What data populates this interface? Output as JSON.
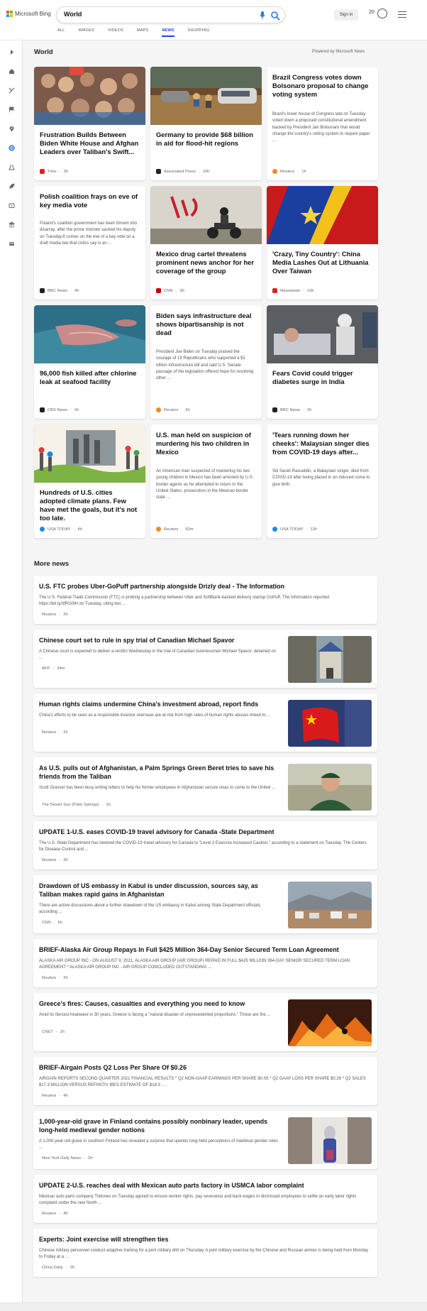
{
  "brand": {
    "name": "Microsoft Bing",
    "colors": [
      "#f25022",
      "#7fba00",
      "#00a4ef",
      "#ffb900"
    ]
  },
  "search": {
    "query": "World",
    "mic_icon": "microphone-icon",
    "search_icon": "search-icon"
  },
  "header": {
    "sign_in": "Sign in",
    "reward_points": "20"
  },
  "tabs": [
    "ALL",
    "IMAGES",
    "VIDEOS",
    "MAPS",
    "NEWS",
    "SHOPPING"
  ],
  "active_tab": "NEWS",
  "rail_icons": [
    "chevron-right-icon",
    "home-icon",
    "sports-icon",
    "flag-icon",
    "location-pin-icon",
    "globe-icon",
    "science-icon",
    "rocket-icon",
    "video-icon",
    "bank-icon",
    "card-icon"
  ],
  "world": {
    "title": "World",
    "powered_by": "Powered by Microsoft News",
    "cards": [
      {
        "title": "Frustration Builds Between Biden White House and Afghan Leaders over Taliban's Swift...",
        "source": "Time",
        "age": "3h",
        "snippet": "",
        "image": "crowd-photo",
        "source_color": "#e02020"
      },
      {
        "title": "Germany to provide $68 billion in aid for flood-hit regions",
        "source": "Associated Press",
        "age": "10h",
        "snippet": "",
        "image": "flood-photo",
        "source_color": "#222222"
      },
      {
        "title": "Brazil Congress votes down Bolsonaro proposal to change voting system",
        "source": "Reuters",
        "age": "1h",
        "snippet": "Brazil's lower house of Congress late on Tuesday voted down a proposed constitutional amendment backed by President Jair Bolsonaro that would change the country's voting system to require paper ...",
        "image": "",
        "source_color": "#f08a24"
      },
      {
        "title": "Polish coalition frays on eve of key media vote",
        "source": "BBC News",
        "age": "4h",
        "snippet": "Poland's coalition government has been thrown into disarray, after the prime minister sacked his deputy on Tuesday.It comes on the eve of a key vote on a draft media law that critics say is an ...",
        "image": "",
        "source_color": "#222222"
      },
      {
        "title": "Mexico drug cartel threatens prominent news anchor for her coverage of the group",
        "source": "CNN",
        "age": "3h",
        "snippet": "",
        "image": "motorbike-photo",
        "source_color": "#cc0000"
      },
      {
        "title": "'Crazy, Tiny Country': China Media Lashes Out at Lithuania Over Taiwan",
        "source": "Newsweek",
        "age": "10h",
        "snippet": "",
        "image": "flag-photo",
        "source_color": "#e02020"
      },
      {
        "title": "96,000 fish killed after chlorine leak at seafood facility",
        "source": "CBS News",
        "age": "2h",
        "snippet": "",
        "image": "fish-photo",
        "source_color": "#222222"
      },
      {
        "title": "Biden says infrastructure deal shows bipartisanship is not dead",
        "source": "Reuters",
        "age": "2h",
        "snippet": "President Joe Biden on Tuesday praised the courage of 19 Republicans who supported a $1 trillion infrastructure bill and said U.S. Senate passage of the legislation offered hope for resolving other ...",
        "image": "",
        "source_color": "#f08a24"
      },
      {
        "title": "Fears Covid could trigger diabetes surge in India",
        "source": "BBC News",
        "age": "2h",
        "snippet": "",
        "image": "hospital-photo",
        "source_color": "#222222"
      },
      {
        "title": "Hundreds of U.S. cities adopted climate plans. Few have met the goals, but it's not too late.",
        "source": "USA TODAY",
        "age": "4h",
        "snippet": "",
        "image": "climate-illustration",
        "source_color": "#1d8ae0"
      },
      {
        "title": "U.S. man held on suspicion of murdering his two children in Mexico",
        "source": "Reuters",
        "age": "50m",
        "snippet": "An American man suspected of murdering his two young children in Mexico has been arrested by U.S. border agents as he attempted to return to the United States, prosecutors in the Mexican border state ...",
        "image": "",
        "source_color": "#f08a24"
      },
      {
        "title": "'Tears running down her cheeks': Malaysian singer dies from COVID-19 days after...",
        "source": "USA TODAY",
        "age": "12h",
        "snippet": "Siti Sarah Raisuddin, a Malaysian singer, died from COVID-19 after being placed in an induced coma to give birth.",
        "image": "",
        "source_color": "#1d8ae0"
      }
    ]
  },
  "more_news": {
    "title": "More news",
    "items": [
      {
        "title": "U.S. FTC probes Uber-GoPuff partnership alongside Drizly deal - The Information",
        "snippet": "The U.S. Federal Trade Commission (FTC) is probing a partnership between Uber and SoftBank-backed delivery startup GoPuff, The Information reported https://bit.ly/3fRG0lH on Tuesday, citing two ...",
        "source": "Reuters",
        "age": "2h",
        "image": "",
        "source_color": "#f08a24"
      },
      {
        "title": "Chinese court set to rule in spy trial of Canadian Michael Spavor",
        "snippet": "A Chinese court is expected to deliver a verdict Wednesday in the trial of Canadian businessman Michael Spavor, detained on ...",
        "source": "AFP",
        "age": "34m",
        "image": "courthouse-photo",
        "source_color": "#1f6fd6"
      },
      {
        "title": "Human rights claims undermine China's investment abroad, report finds",
        "snippet": "China's efforts to be seen as a responsible investor overseas are at risk from high rates of human rights abuses linked to ...",
        "source": "Reuters",
        "age": "2h",
        "image": "china-flag-photo",
        "source_color": "#f08a24"
      },
      {
        "title": "As U.S. pulls out of Afghanistan, a Palm Springs Green Beret tries to save his friends from the Taliban",
        "snippet": "Scott Grasser has been busy writing letters to help his former employees in Afghanistan secure visas to come to the United ...",
        "source": "The Desert Sun (Palm Springs)",
        "age": "1h",
        "image": "soldier-photo",
        "source_color": "#3d7fc0"
      },
      {
        "title": "UPDATE 1-U.S. eases COVID-19 travel advisory for Canada -State Department",
        "snippet": "The U.S. State Department has lowered the COVID-19 travel advisory for Canada to \"Level 2 Exercise Increased Caution,\" according to a statement on Tuesday. The Centers for Disease Control and ...",
        "source": "Reuters",
        "age": "3h",
        "image": "",
        "source_color": "#f08a24"
      },
      {
        "title": "Drawdown of US embassy in Kabul is under discussion, sources say, as Taliban makes rapid gains in Afghanistan",
        "snippet": "There are active discussions about a further drawdown of the US embassy in Kabul among State Department officials, according ...",
        "source": "CNN",
        "age": "5h",
        "image": "kabul-photo",
        "source_color": "#cc0000"
      },
      {
        "title": "BRIEF-Alaska Air Group Repays In Full $425 Million 364-Day Senior Secured Term Loan Agreement",
        "snippet": "ALASKA AIR GROUP INC - ON AUGUST 9, 2021, ALASKA AIR GROUP (AIR GROUP) REPAID IN FULL $425 MILLION 364-DAY SENIOR SECURED TERM LOAN AGREEMENT * ALASKA AIR GROUP INC - AIR GROUP CONCLUDED OUTSTANDING ...",
        "source": "Reuters",
        "age": "3h",
        "image": "",
        "source_color": "#f08a24"
      },
      {
        "title": "Greece's fires: Causes, casualties and everything you need to know",
        "snippet": "Amid its fiercest heatwave in 30 years, Greece is facing a \"natural disaster of unprecedented proportions.\" Those are the ...",
        "source": "CNET",
        "age": "2h",
        "image": "fire-photo",
        "source_color": "#e02020"
      },
      {
        "title": "BRIEF-Airgain Posts Q2 Loss Per Share Of $0.26",
        "snippet": "AIRGAIN REPORTS SECOND QUARTER 2021 FINANCIAL RESULTS * Q2 NON-GAAP EARNINGS PER SHARE $0.05 * Q2 GAAP LOSS PER SHARE $0.26 * Q2 SALES $17.3 MILLION VERSUS REFINITIV IBES ESTIMATE OF $18.3 ...",
        "source": "Reuters",
        "age": "4h",
        "image": "",
        "source_color": "#f08a24"
      },
      {
        "title": "1,000-year-old grave in Finland contains possibly nonbinary leader, upends long-held medieval gender notions",
        "snippet": "A 1,000-year-old grave in southern Finland has revealed a surprise that upends long-held perceptions of medieval gender roles ...",
        "source": "New York Daily News",
        "age": "2h",
        "image": "grave-photo",
        "source_color": "#d0103a"
      },
      {
        "title": "UPDATE 2-U.S. reaches deal with Mexican auto parts factory in USMCA labor complaint",
        "snippet": "Mexican auto parts company Tridonex on Tuesday agreed to ensure worker rights, pay severance and back wages to dismissed employees to settle an early labor rights complaint under the new North ...",
        "source": "Reuters",
        "age": "4h",
        "image": "",
        "source_color": "#f08a24"
      },
      {
        "title": "Experts: Joint exercise will strengthen ties",
        "snippet": "Chinese military personnel conduct adaptive training for a joint military drill on Thursday. A joint military exercise by the Chinese and Russian armies is being held from Monday to Friday at a ...",
        "source": "China Daily",
        "age": "2h",
        "image": "",
        "source_color": "#1f5fb8"
      }
    ]
  }
}
